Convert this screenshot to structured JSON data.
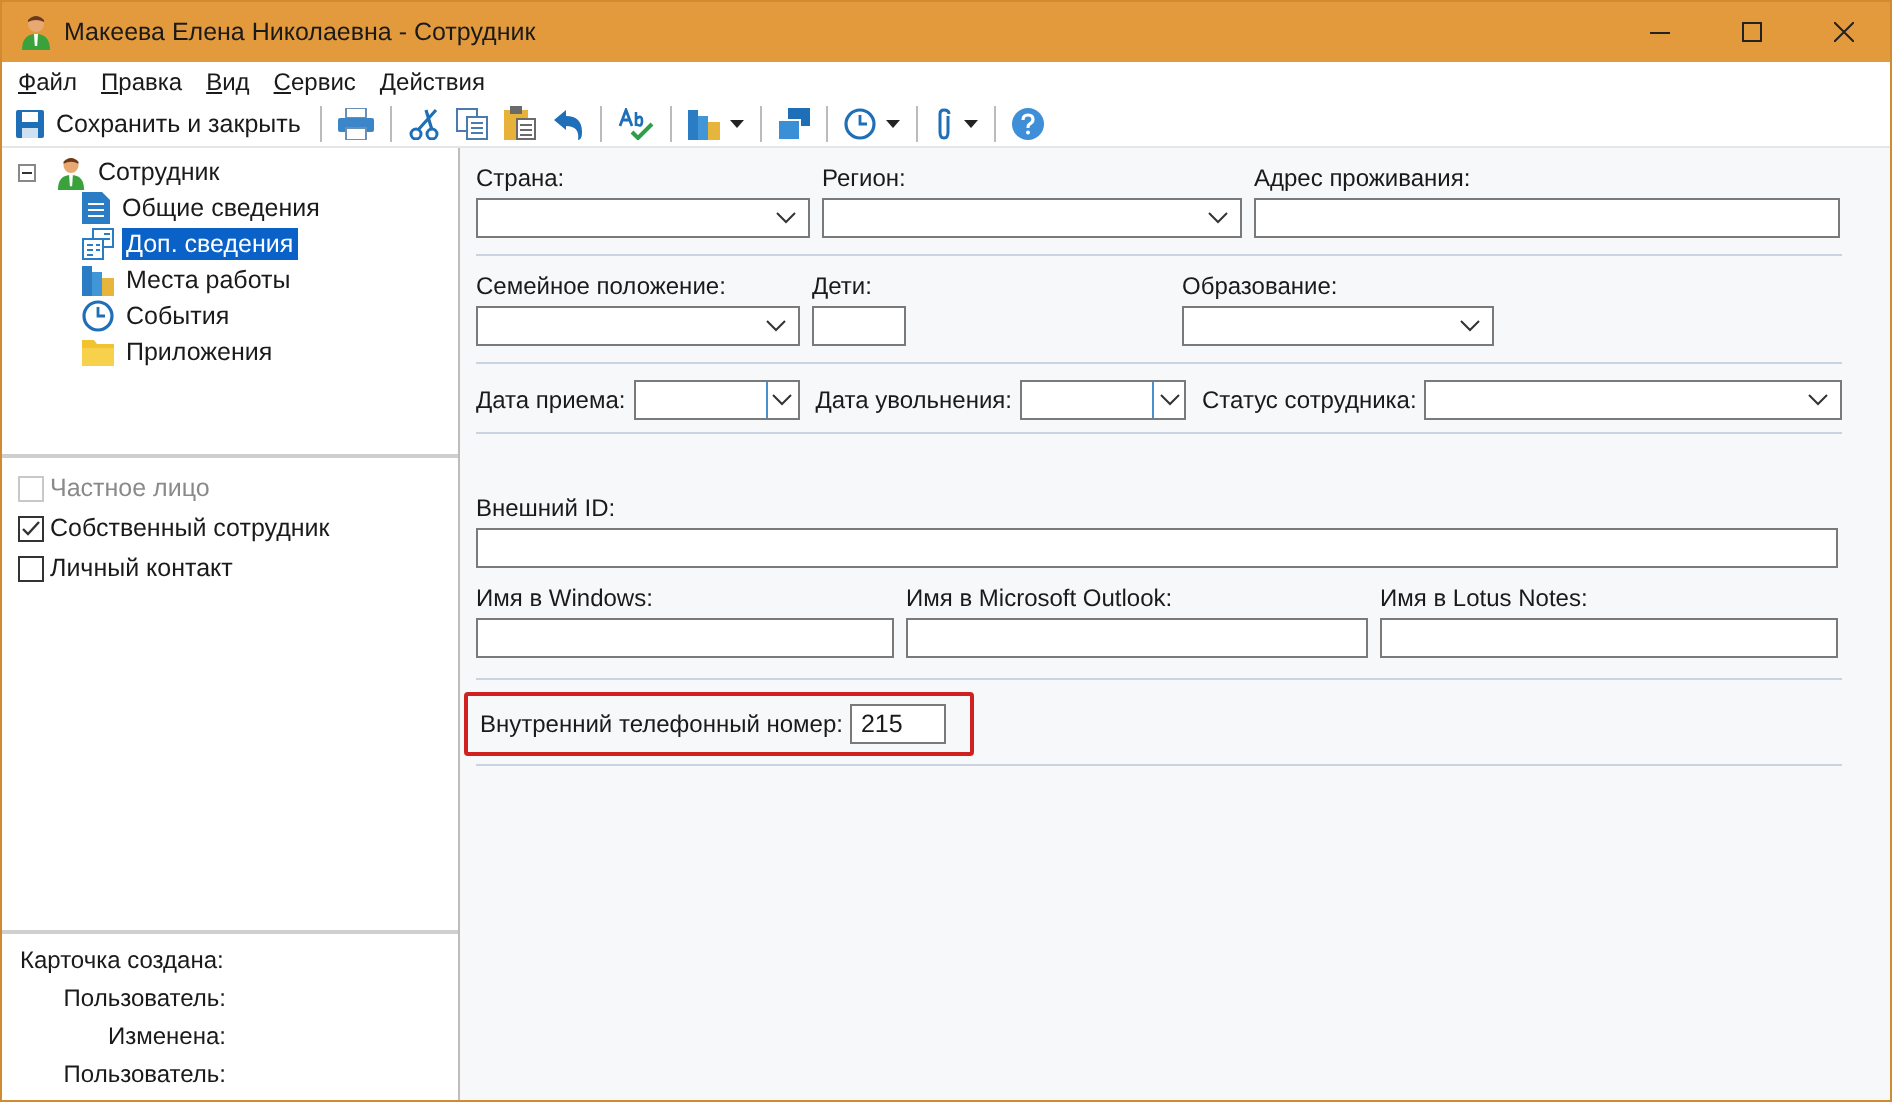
{
  "window": {
    "title": "Макеева Елена Николаевна - Сотрудник"
  },
  "menu": [
    "Файл",
    "Правка",
    "Вид",
    "Сервис",
    "Действия"
  ],
  "toolbar": {
    "save_label": "Сохранить и закрыть"
  },
  "tree": {
    "label": "Сотрудник",
    "expanded": true,
    "children": [
      {
        "label": "Общие сведения",
        "selected": false
      },
      {
        "label": "Доп. сведения",
        "selected": true
      },
      {
        "label": "Места работы",
        "selected": false
      },
      {
        "label": "События",
        "selected": false
      },
      {
        "label": "Приложения",
        "selected": false
      }
    ]
  },
  "options": [
    {
      "label": "Частное лицо",
      "checked": false,
      "disabled": true
    },
    {
      "label": "Собственный сотрудник",
      "checked": true,
      "disabled": false
    },
    {
      "label": "Личный контакт",
      "checked": false,
      "disabled": false
    }
  ],
  "card_info": [
    "Карточка создана:",
    "Пользователь:",
    "Изменена:",
    "Пользователь:"
  ],
  "sections": [
    {
      "fields": [
        {
          "label": "Страна:",
          "kind": "combo"
        },
        {
          "label": "Регион:",
          "kind": "combo"
        },
        {
          "label": "Адрес проживания:",
          "kind": "text"
        }
      ]
    },
    {
      "fields": [
        {
          "label": "Семейное положение:",
          "kind": "combo"
        },
        {
          "label": "Дети:",
          "kind": "text"
        },
        {
          "label": "Образование:",
          "kind": "combo"
        }
      ]
    },
    {
      "fields": [
        {
          "label": "Дата приема:",
          "kind": "date"
        },
        {
          "label": "Дата увольнения:",
          "kind": "date"
        },
        {
          "label": "Статус сотрудника:",
          "kind": "combo"
        }
      ]
    },
    {
      "fields": [
        {
          "label": "Внешний ID:",
          "kind": "text"
        },
        {
          "label": "Имя в Windows:",
          "kind": "text"
        },
        {
          "label": "Имя в Microsoft Outlook:",
          "kind": "text"
        },
        {
          "label": "Имя в Lotus Notes:",
          "kind": "text"
        }
      ]
    },
    {
      "fields": [
        {
          "label": "Внутренний телефонный номер:",
          "kind": "text",
          "value": "215",
          "highlighted": true
        }
      ]
    }
  ]
}
